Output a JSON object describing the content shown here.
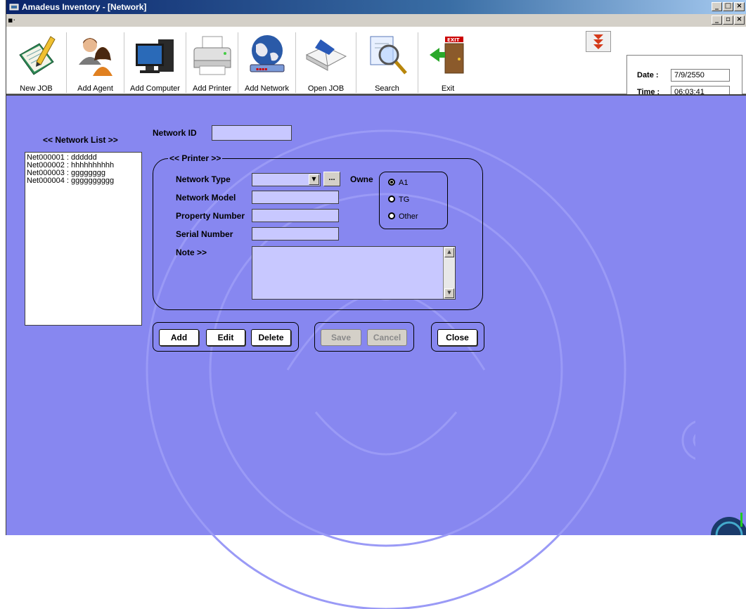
{
  "window": {
    "title": "Amadeus Inventory - [Network]"
  },
  "toolbar": {
    "items": [
      {
        "label": "New JOB",
        "icon": "notebook-pencil-icon"
      },
      {
        "label": "Add Agent",
        "icon": "agents-icon"
      },
      {
        "label": "Add Computer",
        "icon": "computer-icon"
      },
      {
        "label": "Add Printer",
        "icon": "printer-icon"
      },
      {
        "label": "Add Network",
        "icon": "network-globe-icon"
      },
      {
        "label": "Open JOB",
        "icon": "open-book-icon"
      },
      {
        "label": "Search",
        "icon": "search-magnifier-icon"
      },
      {
        "label": "Exit",
        "icon": "exit-door-icon"
      }
    ]
  },
  "datetime": {
    "date_label": "Date :",
    "date_value": "7/9/2550",
    "time_label": "Time :",
    "time_value": "06:03:41"
  },
  "network_list": {
    "title": "<< Network List >>",
    "items": [
      "Net000001 : dddddd",
      "Net000002 : hhhhhhhhhh",
      "Net000003 : gggggggg",
      "Net000004 : gggggggggg"
    ]
  },
  "form": {
    "network_id_label": "Network ID",
    "network_id_value": "",
    "group_title": "<< Printer >>",
    "network_type_label": "Network Type",
    "network_type_value": "",
    "browse_label": "...",
    "owner_label": "Owne",
    "network_model_label": "Network Model",
    "network_model_value": "",
    "property_number_label": "Property Number",
    "property_number_value": "",
    "serial_number_label": "Serial Number",
    "serial_number_value": "",
    "note_label": "Note >>",
    "note_value": "",
    "owner_options": [
      {
        "label": "A1",
        "selected": true
      },
      {
        "label": "TG",
        "selected": false
      },
      {
        "label": "Other",
        "selected": false
      }
    ]
  },
  "buttons": {
    "add": "Add",
    "edit": "Edit",
    "delete": "Delete",
    "save": "Save",
    "cancel": "Cancel",
    "close": "Close"
  },
  "colors": {
    "client_background": "#8787f0",
    "field_background": "#c8c8ff",
    "titlebar": "#0a246a"
  }
}
